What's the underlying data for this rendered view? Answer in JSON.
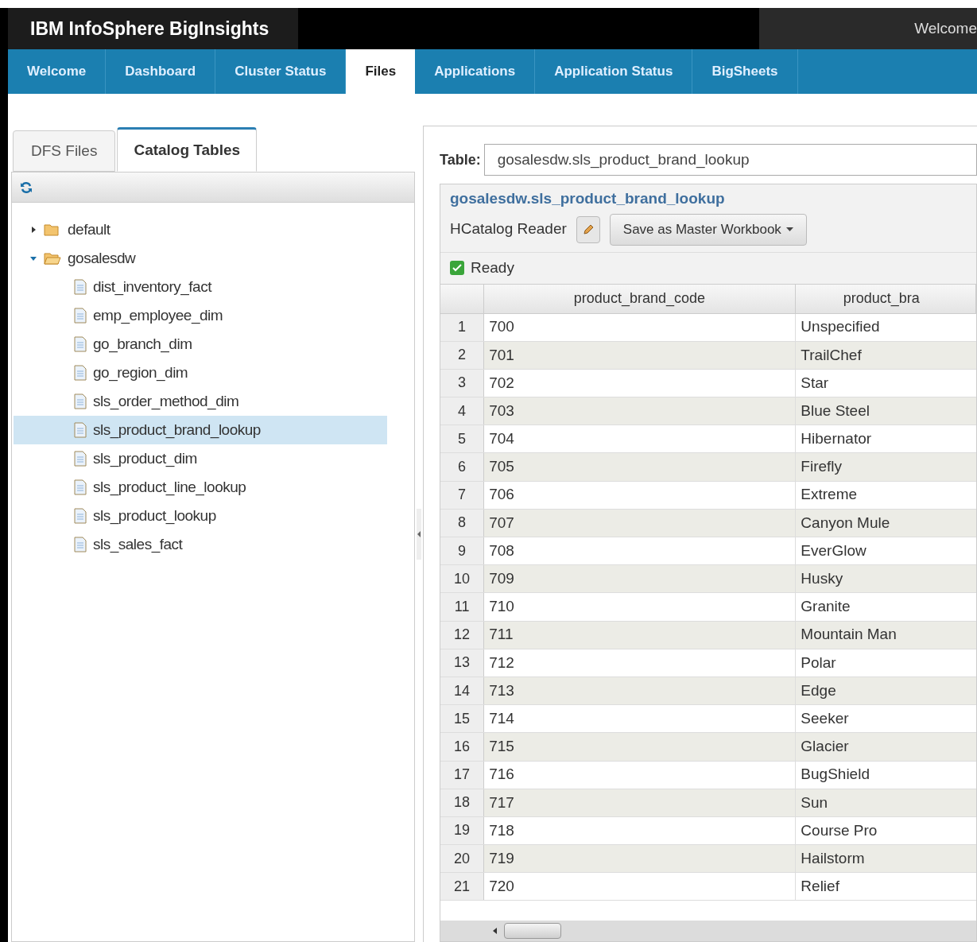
{
  "header": {
    "title": "IBM InfoSphere BigInsights",
    "welcome": "Welcome"
  },
  "nav_tabs": [
    {
      "label": "Welcome",
      "selected": false
    },
    {
      "label": "Dashboard",
      "selected": false
    },
    {
      "label": "Cluster Status",
      "selected": false
    },
    {
      "label": "Files",
      "selected": true
    },
    {
      "label": "Applications",
      "selected": false
    },
    {
      "label": "Application Status",
      "selected": false
    },
    {
      "label": "BigSheets",
      "selected": false
    }
  ],
  "left_panel": {
    "tabs": [
      {
        "label": "DFS Files",
        "selected": false
      },
      {
        "label": "Catalog Tables",
        "selected": true
      }
    ],
    "tree": [
      {
        "label": "default",
        "expanded": false,
        "selected": false
      },
      {
        "label": "gosalesdw",
        "expanded": true,
        "selected": false,
        "children": [
          {
            "label": "dist_inventory_fact",
            "selected": false
          },
          {
            "label": "emp_employee_dim",
            "selected": false
          },
          {
            "label": "go_branch_dim",
            "selected": false
          },
          {
            "label": "go_region_dim",
            "selected": false
          },
          {
            "label": "sls_order_method_dim",
            "selected": false
          },
          {
            "label": "sls_product_brand_lookup",
            "selected": true
          },
          {
            "label": "sls_product_dim",
            "selected": false
          },
          {
            "label": "sls_product_line_lookup",
            "selected": false
          },
          {
            "label": "sls_product_lookup",
            "selected": false
          },
          {
            "label": "sls_sales_fact",
            "selected": false
          }
        ]
      }
    ]
  },
  "right_panel": {
    "table_label": "Table:",
    "table_value": "gosalesdw.sls_product_brand_lookup",
    "title": "gosalesdw.sls_product_brand_lookup",
    "reader": "HCatalog Reader",
    "save_button": "Save as Master Workbook",
    "status": "Ready",
    "columns": [
      "product_brand_code",
      "product_bra"
    ],
    "rows": [
      {
        "n": "1",
        "code": "700",
        "name": "Unspecified"
      },
      {
        "n": "2",
        "code": "701",
        "name": "TrailChef"
      },
      {
        "n": "3",
        "code": "702",
        "name": "Star"
      },
      {
        "n": "4",
        "code": "703",
        "name": "Blue Steel"
      },
      {
        "n": "5",
        "code": "704",
        "name": "Hibernator"
      },
      {
        "n": "6",
        "code": "705",
        "name": "Firefly"
      },
      {
        "n": "7",
        "code": "706",
        "name": "Extreme"
      },
      {
        "n": "8",
        "code": "707",
        "name": "Canyon Mule"
      },
      {
        "n": "9",
        "code": "708",
        "name": "EverGlow"
      },
      {
        "n": "10",
        "code": "709",
        "name": "Husky"
      },
      {
        "n": "11",
        "code": "710",
        "name": "Granite"
      },
      {
        "n": "12",
        "code": "711",
        "name": "Mountain Man"
      },
      {
        "n": "13",
        "code": "712",
        "name": "Polar"
      },
      {
        "n": "14",
        "code": "713",
        "name": "Edge"
      },
      {
        "n": "15",
        "code": "714",
        "name": "Seeker"
      },
      {
        "n": "16",
        "code": "715",
        "name": "Glacier"
      },
      {
        "n": "17",
        "code": "716",
        "name": "BugShield"
      },
      {
        "n": "18",
        "code": "717",
        "name": "Sun"
      },
      {
        "n": "19",
        "code": "718",
        "name": "Course Pro"
      },
      {
        "n": "20",
        "code": "719",
        "name": "Hailstorm"
      },
      {
        "n": "21",
        "code": "720",
        "name": "Relief"
      }
    ]
  }
}
